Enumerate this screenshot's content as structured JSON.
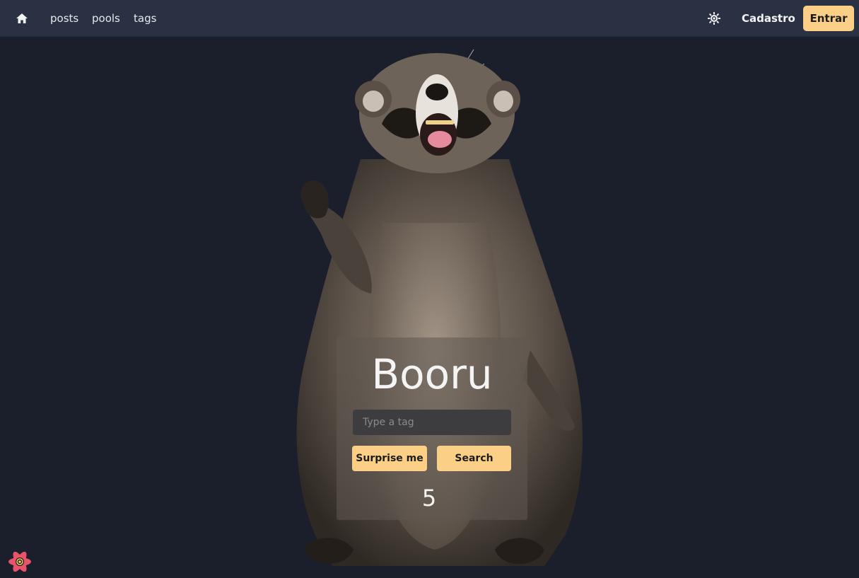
{
  "nav": {
    "links": [
      "posts",
      "pools",
      "tags"
    ],
    "signup_label": "Cadastro",
    "login_label": "Entrar"
  },
  "hero": {
    "title": "Booru",
    "search_placeholder": "Type a tag",
    "surprise_label": "Surprise me",
    "search_label": "Search",
    "count": "5"
  },
  "colors": {
    "background": "#1b1f2b",
    "topbar": "#2a3142",
    "accent": "#fccf86"
  },
  "icons": {
    "home": "home-icon",
    "theme": "sun-icon",
    "devtools": "react-devtools-icon"
  }
}
